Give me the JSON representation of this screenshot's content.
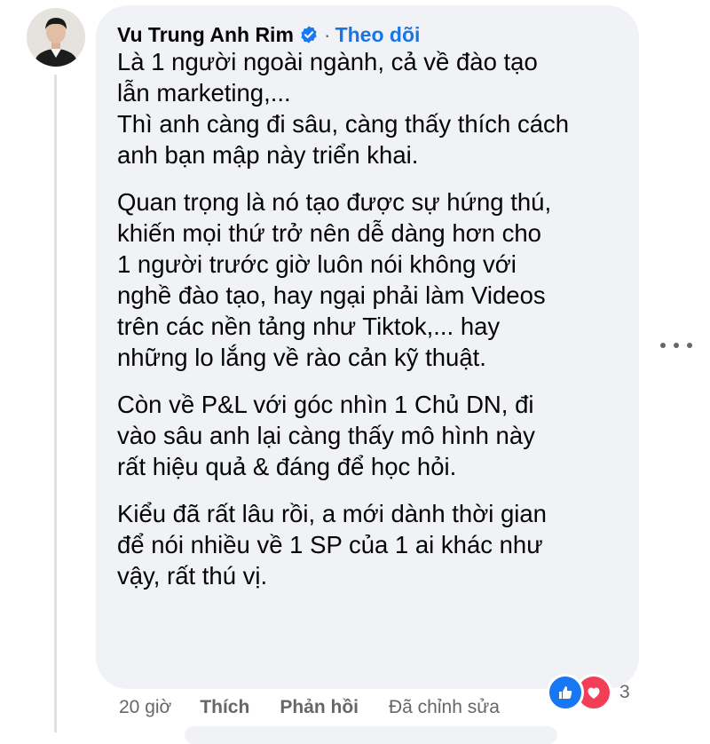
{
  "comment": {
    "author": "Vu Trung Anh Rim",
    "follow_label": "Theo dõi",
    "separator": "·",
    "paragraphs": [
      [
        "Là 1 người ngoài ngành, cả về đào tạo",
        "lẫn marketing,...",
        "Thì anh càng đi sâu, càng thấy thích cách",
        "anh bạn mập này triển khai."
      ],
      [
        "Quan trọng là nó tạo được sự hứng thú,",
        "khiến mọi thứ trở nên dễ dàng hơn cho",
        "1 người trước giờ luôn nói không với",
        "nghề đào tạo, hay ngại phải làm Videos",
        "trên các nền tảng như Tiktok,... hay",
        "những lo lắng về rào cản kỹ thuật."
      ],
      [
        "Còn về P&L với góc nhìn 1 Chủ DN, đi",
        "vào sâu anh lại càng thấy mô hình này",
        "rất hiệu quả & đáng để học hỏi."
      ],
      [
        "Kiểu đã rất lâu rồi, a mới dành thời gian",
        "để nói nhiều về 1 SP của 1 ai khác như",
        "vậy, rất thú vị."
      ]
    ],
    "time": "20 giờ",
    "like_label": "Thích",
    "reply_label": "Phản hồi",
    "edited_label": "Đã chỉnh sửa",
    "reaction_count": "3",
    "reactions": [
      "like-icon",
      "love-icon"
    ]
  },
  "colors": {
    "bubble": "#f0f2f5",
    "link": "#1b74e4",
    "like": "#1877f2",
    "love": "#f33e58",
    "muted": "#65676b"
  }
}
